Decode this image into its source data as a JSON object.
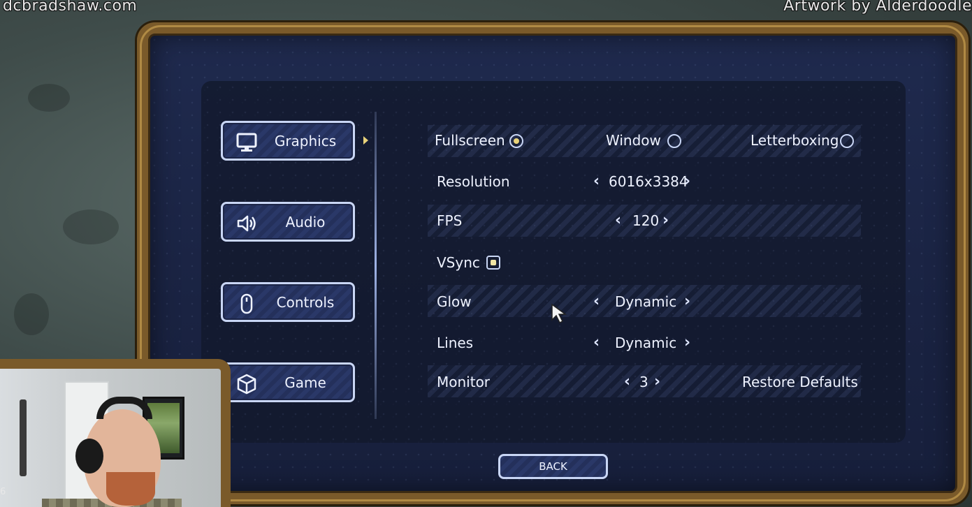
{
  "watermarks": {
    "left": "dcbradshaw.com",
    "right": "Artwork by Alderdoodle"
  },
  "categories": [
    {
      "label": "Graphics",
      "icon": "monitor-icon",
      "selected": true
    },
    {
      "label": "Audio",
      "icon": "speaker-icon",
      "selected": false
    },
    {
      "label": "Controls",
      "icon": "mouse-icon",
      "selected": false
    },
    {
      "label": "Game",
      "icon": "cube-icon",
      "selected": false
    }
  ],
  "graphics": {
    "display_modes": [
      {
        "label": "Fullscreen",
        "selected": true
      },
      {
        "label": "Window",
        "selected": false
      },
      {
        "label": "Letterboxing",
        "selected": false
      }
    ],
    "resolution": {
      "label": "Resolution",
      "value": "6016x3384"
    },
    "fps": {
      "label": "FPS",
      "value": "120"
    },
    "vsync": {
      "label": "VSync",
      "checked": true
    },
    "glow": {
      "label": "Glow",
      "value": "Dynamic"
    },
    "lines": {
      "label": "Lines",
      "value": "Dynamic"
    },
    "monitor": {
      "label": "Monitor",
      "value": "3"
    },
    "restore_defaults": "Restore Defaults"
  },
  "back_label": "BACK",
  "webcam_counter": "6",
  "colors": {
    "accent": "#e8d27a",
    "panel": "#1a2342",
    "frame": "#7a5a2a",
    "outline": "#c9d6f5"
  }
}
